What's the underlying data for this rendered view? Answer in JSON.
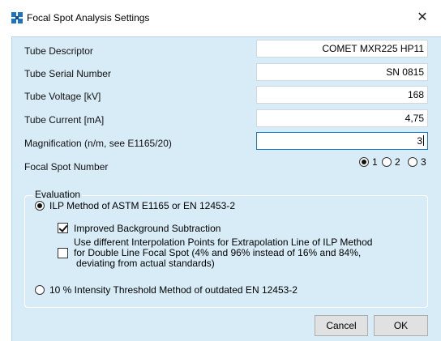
{
  "window": {
    "title": "Focal Spot Analysis Settings",
    "close_glyph": "✕",
    "app_icon": "focal-spot-app-icon"
  },
  "fields": [
    {
      "label": "Tube Descriptor",
      "value": "COMET MXR225 HP11"
    },
    {
      "label": "Tube Serial Number",
      "value": "SN  0815"
    },
    {
      "label": "Tube Voltage [kV]",
      "value": "168"
    },
    {
      "label": "Tube Current [mA]",
      "value": "4,75"
    },
    {
      "label": "Magnification (n/m, see E1165/20)",
      "value": "3"
    }
  ],
  "focal_spot": {
    "label": "Focal Spot Number",
    "options": [
      "1",
      "2",
      "3"
    ],
    "selected": "1"
  },
  "evaluation": {
    "title": "Evaluation",
    "ilp_label": "ILP Method of ASTM E1165 or EN 12453-2",
    "ilp_selected": true,
    "improved_bg_label": "Improved Background Subtraction",
    "improved_bg_checked": true,
    "interp_lines": [
      "Use different Interpolation Points for Extrapolation Line of ILP Method",
      "for Double Line Focal Spot (4% and 96% instead of 16% and 84%,",
      "deviating from actual standards)"
    ],
    "interp_checked": false,
    "threshold_label": "10 % Intensity Threshold Method of outdated EN 12453-2",
    "threshold_selected": false
  },
  "buttons": {
    "cancel": "Cancel",
    "ok": "OK"
  },
  "colors": {
    "client_bg": "#d8ecf8",
    "accent": "#1778d2",
    "icon_blue": "#1e73be"
  }
}
